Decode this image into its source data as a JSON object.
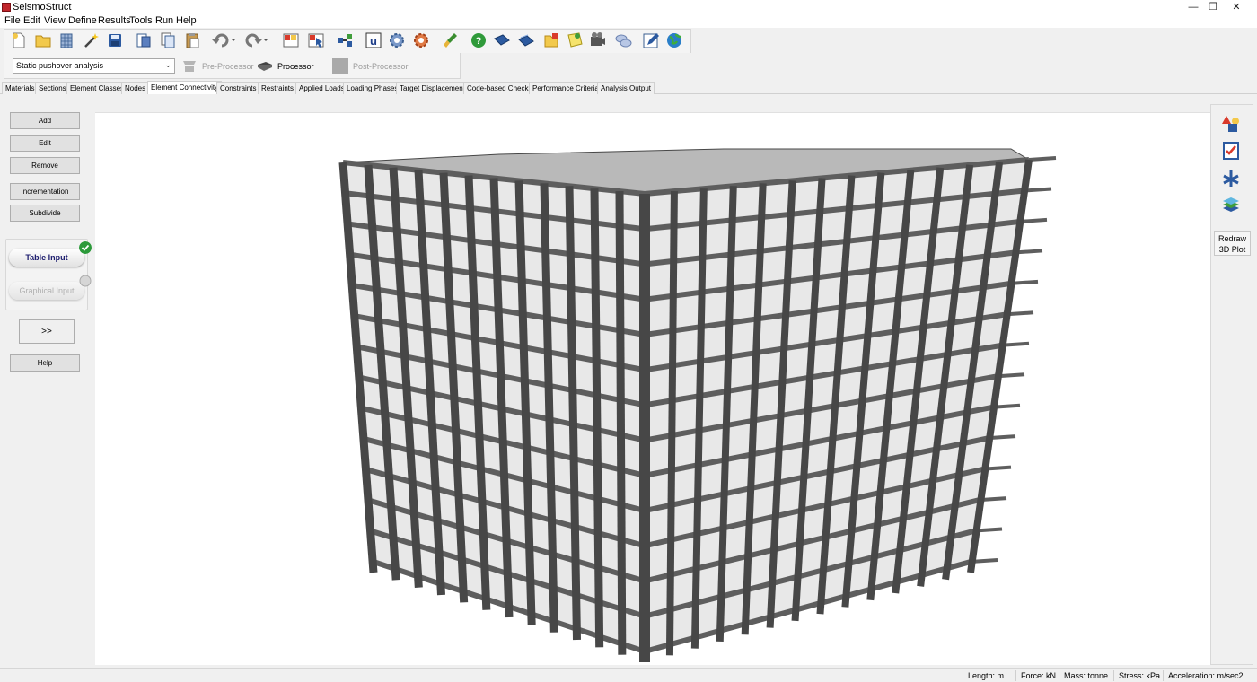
{
  "window": {
    "title": "SeismoStruct",
    "controls": {
      "minimize": "—",
      "restore": "❐",
      "close": "✕"
    }
  },
  "menu": [
    "File",
    "Edit",
    "View",
    "Define",
    "Results",
    "Tools",
    "Run",
    "Help"
  ],
  "toolbar": {
    "icons": [
      "new-file-icon",
      "open-folder-icon",
      "building-icon",
      "wizard-wand-icon",
      "save-disk-icon",
      "report-icon",
      "copy-icon",
      "paste-icon",
      "undo-icon",
      "redo-icon",
      "element-grid-icon",
      "element-select-icon",
      "connectivity-icon",
      "u-icon",
      "settings-gear-icon",
      "advanced-settings-icon",
      "brush-icon",
      "help-icon",
      "book-icon",
      "books-icon",
      "folder-icon",
      "notes-icon",
      "movie-icon",
      "chat-icon",
      "edit-pencil-icon",
      "globe-icon"
    ]
  },
  "analysis": {
    "selected_type": "Static pushover analysis",
    "modes": {
      "pre": "Pre-Processor",
      "proc": "Processor",
      "post": "Post-Processor"
    },
    "active_mode": "Processor"
  },
  "tabs": [
    "Materials",
    "Sections",
    "Element Classes",
    "Nodes",
    "Element Connectivity",
    "Constraints",
    "Restraints",
    "Applied Loads",
    "Loading Phases",
    "Target Displacement",
    "Code-based Checks",
    "Performance Criteria",
    "Analysis Output"
  ],
  "active_tab": "Element Connectivity",
  "left_panel": {
    "add": "Add",
    "edit": "Edit",
    "remove": "Remove",
    "incrementation": "Incrementation",
    "subdivide": "Subdivide",
    "table_input": "Table Input",
    "graphical_input": "Graphical Input",
    "expand": ">>",
    "help": "Help"
  },
  "right_panel": {
    "redraw_line1": "Redraw",
    "redraw_line2": "3D Plot",
    "icons": [
      "shapes-icon",
      "checklist-icon",
      "axes-icon",
      "layers-icon"
    ]
  },
  "status": {
    "length": "Length: m",
    "force": "Force: kN",
    "mass": "Mass: tonne",
    "stress": "Stress: kPa",
    "acceleration": "Acceleration: m/sec2"
  },
  "colors": {
    "frame": "#5e5e5e",
    "frame_dark": "#474747",
    "slab": "#b9b9b9",
    "infill": "#d6d6d6"
  }
}
